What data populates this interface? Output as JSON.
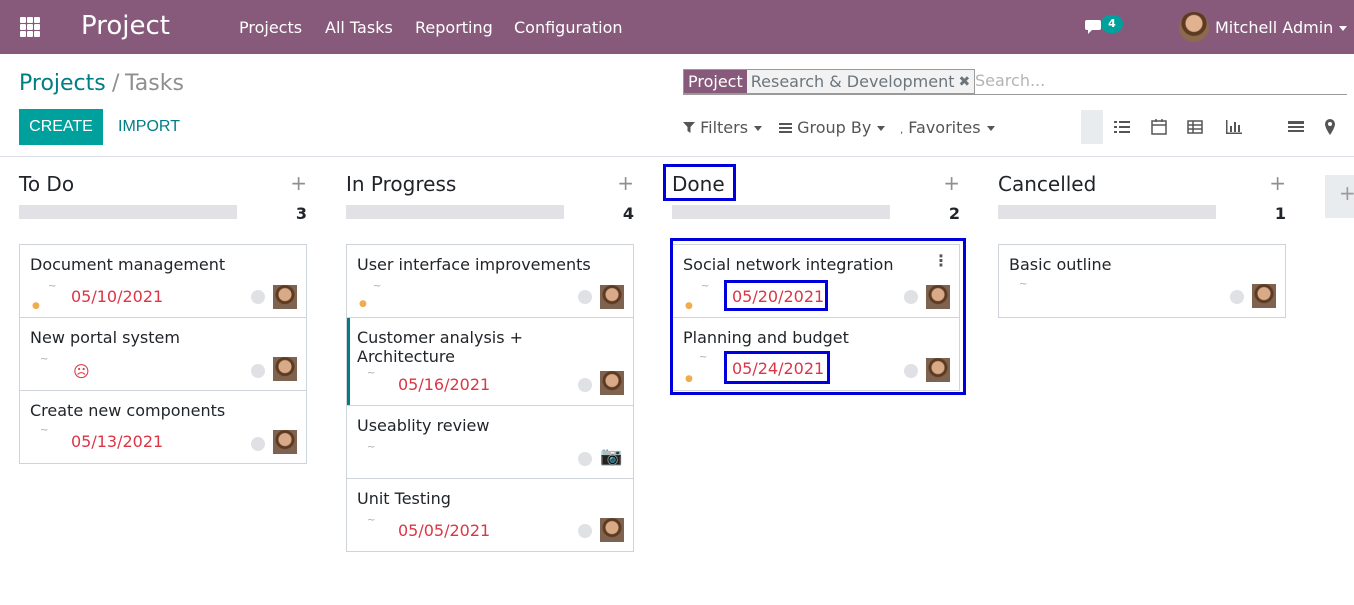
{
  "nav": {
    "app_title": "Project",
    "menu": [
      "Projects",
      "All Tasks",
      "Reporting",
      "Configuration"
    ],
    "chat_count": "4",
    "user_name": "Mitchell Admin",
    "brand_color": "#875a7b"
  },
  "breadcrumb": {
    "parent": "Projects",
    "separator": "/",
    "current": "Tasks"
  },
  "actions": {
    "create": "CREATE",
    "import": "IMPORT"
  },
  "search": {
    "facet_label": "Project",
    "facet_value": "Research & Development",
    "placeholder": "Search..."
  },
  "filters": {
    "filters": "Filters",
    "group_by": "Group By",
    "favorites": "Favorites"
  },
  "views": [
    "kanban",
    "list",
    "calendar",
    "pivot",
    "graph",
    "activity",
    "map"
  ],
  "columns": [
    {
      "title": "To Do",
      "count": "3",
      "cards": [
        {
          "title": "Document management",
          "date": "05/10/2021"
        },
        {
          "title": "New portal system",
          "date": "",
          "sad": "☹"
        },
        {
          "title": "Create new components",
          "date": "05/13/2021"
        }
      ]
    },
    {
      "title": "In Progress",
      "count": "4",
      "cards": [
        {
          "title": "User interface improvements",
          "date": ""
        },
        {
          "title": "Customer analysis + Architecture",
          "date": "05/16/2021"
        },
        {
          "title": "Useablity review",
          "date": ""
        },
        {
          "title": "Unit Testing",
          "date": "05/05/2021"
        }
      ]
    },
    {
      "title": "Done",
      "count": "2",
      "cards": [
        {
          "title": "Social network integration",
          "date": "05/20/2021"
        },
        {
          "title": "Planning and budget",
          "date": "05/24/2021"
        }
      ]
    },
    {
      "title": "Cancelled",
      "count": "1",
      "cards": [
        {
          "title": "Basic outline",
          "date": ""
        }
      ]
    }
  ],
  "add_column_symbol": "+",
  "add_card_symbol": "+",
  "card_menu_symbol": "⋮",
  "tilde": "~",
  "dot": "●"
}
